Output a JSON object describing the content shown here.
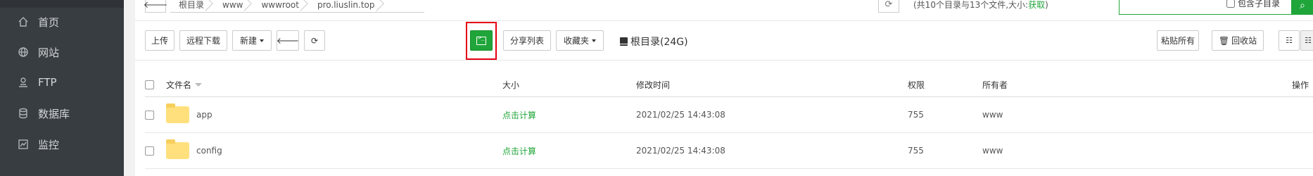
{
  "sidebar": {
    "items": [
      {
        "label": "首页",
        "icon": "home-icon"
      },
      {
        "label": "网站",
        "icon": "globe-icon"
      },
      {
        "label": "FTP",
        "icon": "ftp-icon"
      },
      {
        "label": "数据库",
        "icon": "database-icon"
      },
      {
        "label": "监控",
        "icon": "monitor-icon"
      }
    ]
  },
  "address": {
    "back_icon": "🡐",
    "crumbs": [
      "根目录",
      "www",
      "wwwroot",
      "pro.liuslin.top"
    ],
    "info_text": "(共10个目录与13个文件,大小:",
    "info_link": "获取",
    "info_close": ")",
    "include_subdir": "包含子目录"
  },
  "toolbar": {
    "upload": "上传",
    "remote_download": "远程下载",
    "new": "新建",
    "back_symbol": "🡐",
    "refresh_symbol": "⟳",
    "share_list": "分享列表",
    "favorites": "收藏夹",
    "disk_label": "根目录(24G)",
    "paste_all": "粘贴所有",
    "recycle_bin": "回收站"
  },
  "table": {
    "headers": {
      "name": "文件名",
      "size": "大小",
      "mtime": "修改时间",
      "perm": "权限",
      "owner": "所有者",
      "ops": "操作"
    },
    "rows": [
      {
        "name": "app",
        "size": "点击计算",
        "mtime": "2021/02/25 14:43:08",
        "perm": "755",
        "owner": "www"
      },
      {
        "name": "config",
        "size": "点击计算",
        "mtime": "2021/02/25 14:43:08",
        "perm": "755",
        "owner": "www"
      }
    ]
  },
  "colors": {
    "accent": "#20a53a",
    "sidebar_bg": "#383d41",
    "highlight": "#e60012",
    "folder": "#ffe07d"
  }
}
